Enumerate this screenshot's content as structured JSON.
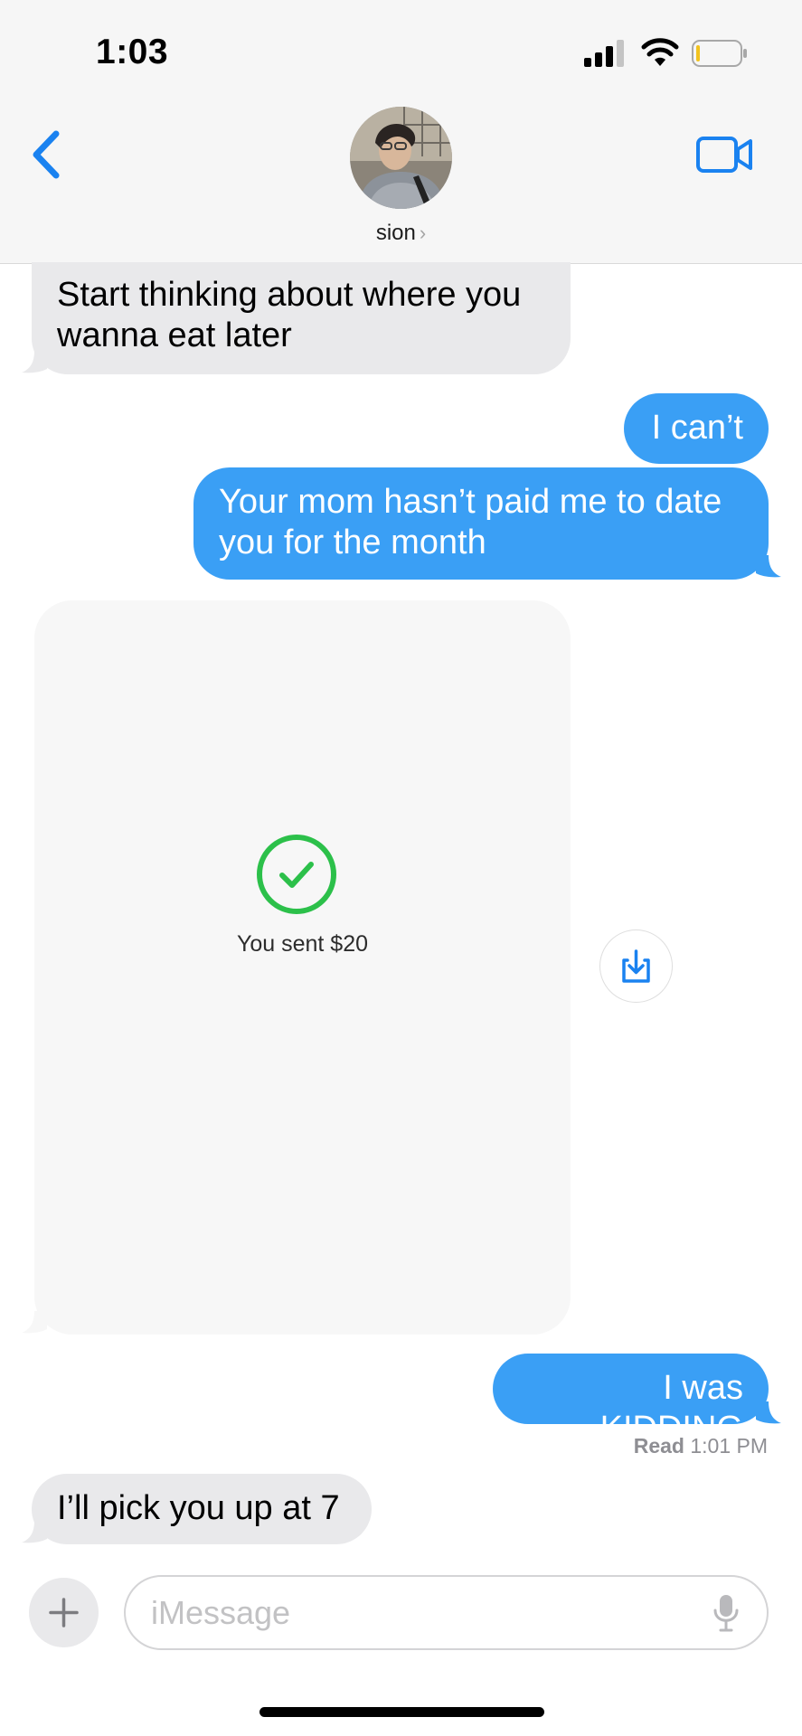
{
  "status_bar": {
    "time": "1:03"
  },
  "header": {
    "contact_name": "sion",
    "chevron": "›"
  },
  "messages": [
    {
      "side": "in",
      "text_line1": "Start thinking about where you",
      "text_line2": "wanna eat later"
    },
    {
      "side": "out",
      "text": "I can’t"
    },
    {
      "side": "out",
      "text_line1": "Your mom hasn’t paid me to date",
      "text_line2": "you for the month"
    },
    {
      "side": "in",
      "type": "payment",
      "payment_text": "You sent $20"
    },
    {
      "side": "out",
      "text": "I was KIDDING"
    },
    {
      "side": "in",
      "text": "I’ll pick you up at 7"
    }
  ],
  "read_receipt": {
    "label": "Read",
    "time": "1:01 PM"
  },
  "composer": {
    "placeholder": "iMessage"
  },
  "colors": {
    "accent": "#3a9ff5",
    "incoming": "#e9e9eb",
    "link_blue": "#1a82f0",
    "success_green": "#2cc04a"
  }
}
